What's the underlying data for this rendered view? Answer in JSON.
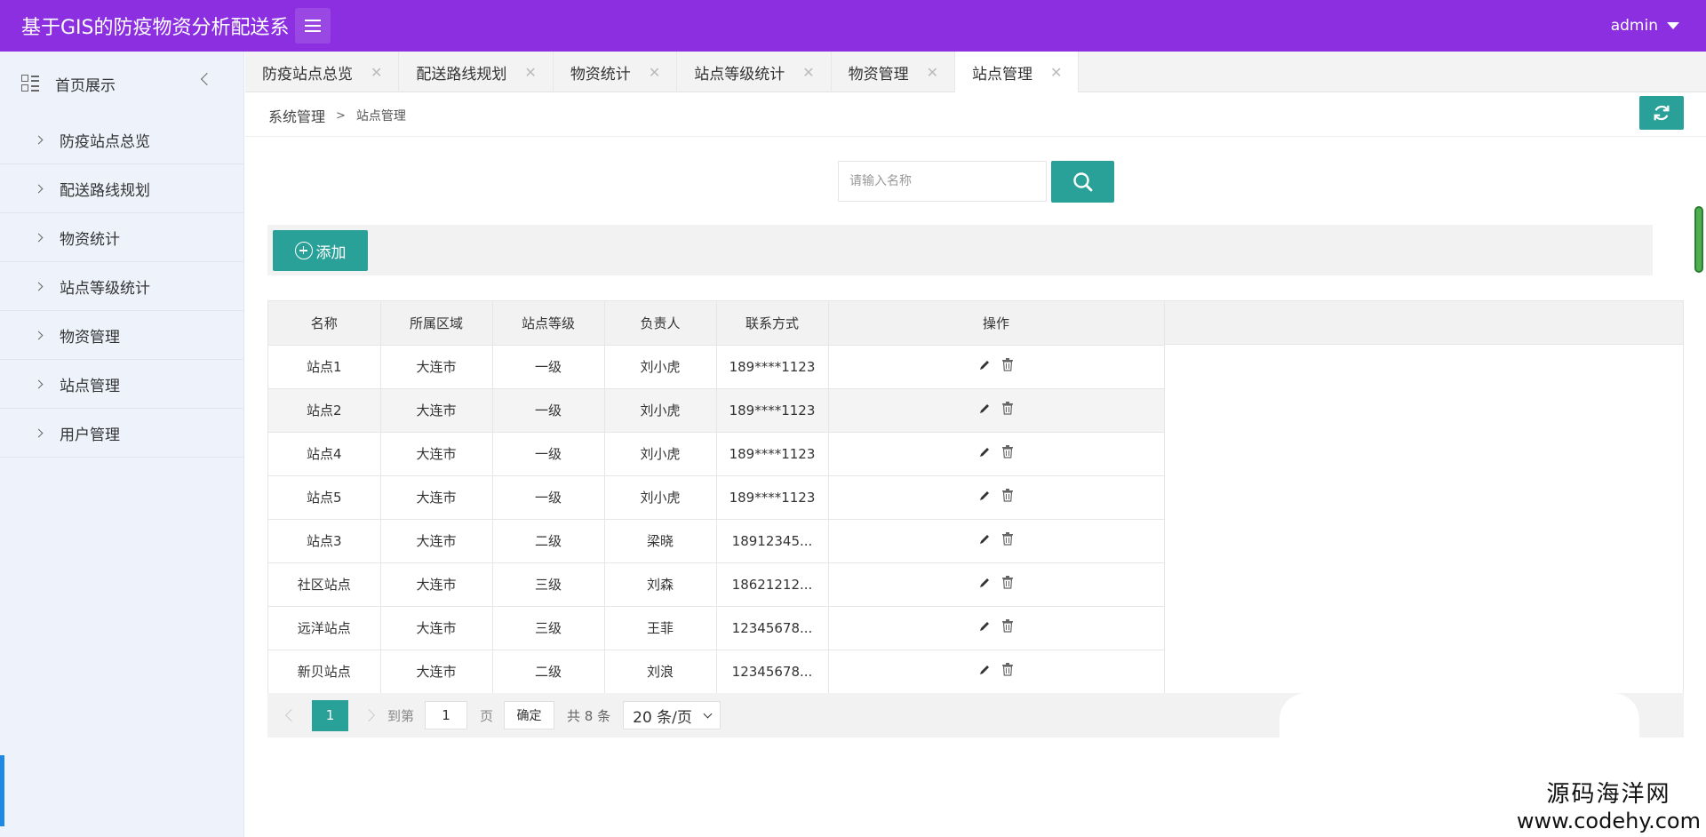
{
  "header": {
    "title": "基于GIS的防疫物资分析配送系",
    "user": "admin"
  },
  "sidebar": {
    "home_label": "首页展示",
    "items": [
      {
        "label": "防疫站点总览"
      },
      {
        "label": "配送路线规划"
      },
      {
        "label": "物资统计"
      },
      {
        "label": "站点等级统计"
      },
      {
        "label": "物资管理"
      },
      {
        "label": "站点管理"
      },
      {
        "label": "用户管理"
      }
    ]
  },
  "tabs": [
    {
      "label": "防疫站点总览"
    },
    {
      "label": "配送路线规划"
    },
    {
      "label": "物资统计"
    },
    {
      "label": "站点等级统计"
    },
    {
      "label": "物资管理"
    },
    {
      "label": "站点管理"
    }
  ],
  "tab_close_glyph": "✕",
  "breadcrumb": {
    "root": "系统管理",
    "sep": ">",
    "current": "站点管理"
  },
  "search": {
    "placeholder": "请输入名称",
    "value": ""
  },
  "toolbar": {
    "add_label": "添加"
  },
  "table": {
    "columns": [
      "名称",
      "所属区域",
      "站点等级",
      "负责人",
      "联系方式",
      "操作"
    ],
    "rows": [
      {
        "name": "站点1",
        "area": "大连市",
        "level": "一级",
        "owner": "刘小虎",
        "contact": "189****1123"
      },
      {
        "name": "站点2",
        "area": "大连市",
        "level": "一级",
        "owner": "刘小虎",
        "contact": "189****1123"
      },
      {
        "name": "站点4",
        "area": "大连市",
        "level": "一级",
        "owner": "刘小虎",
        "contact": "189****1123"
      },
      {
        "name": "站点5",
        "area": "大连市",
        "level": "一级",
        "owner": "刘小虎",
        "contact": "189****1123"
      },
      {
        "name": "站点3",
        "area": "大连市",
        "level": "二级",
        "owner": "梁晓",
        "contact": "18912345..."
      },
      {
        "name": "社区站点",
        "area": "大连市",
        "level": "三级",
        "owner": "刘森",
        "contact": "18621212..."
      },
      {
        "name": "远洋站点",
        "area": "大连市",
        "level": "三级",
        "owner": "王菲",
        "contact": "12345678..."
      },
      {
        "name": "新贝站点",
        "area": "大连市",
        "level": "二级",
        "owner": "刘浪",
        "contact": "12345678..."
      }
    ]
  },
  "pagination": {
    "current_page": "1",
    "goto_label": "到第",
    "goto_value": "1",
    "page_unit": "页",
    "confirm_label": "确定",
    "total_label": "共 8 条",
    "page_size_label": "20 条/页"
  },
  "watermark": {
    "line1": "源码海洋网",
    "line2": "www.codehy.com"
  },
  "colors": {
    "header": "#8b2fe0",
    "accent": "#2aa198",
    "sidebar": "#eef3fb"
  }
}
